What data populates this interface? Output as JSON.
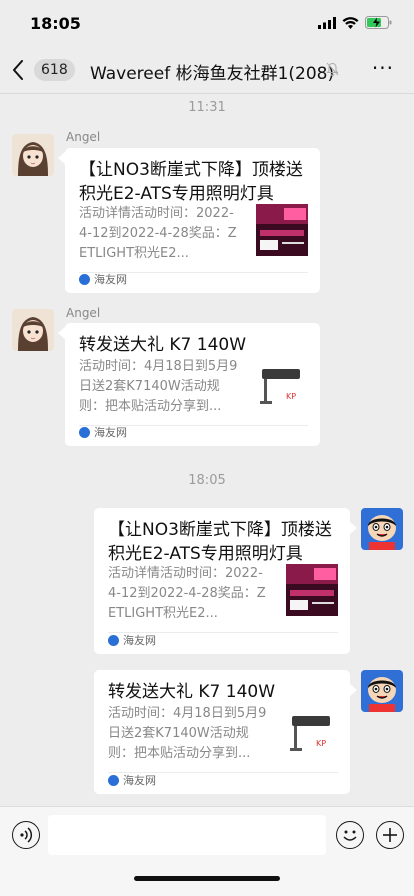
{
  "status_bar": {
    "time": "18:05"
  },
  "nav": {
    "back_icon": "chevron-left-icon",
    "unread_count": "618",
    "title": "Wavereef 彬海鱼友社群1(208)",
    "mute_icon": "mute-bell-icon",
    "more_label": "···"
  },
  "timestamps": [
    "11:31",
    "18:05"
  ],
  "messages": [
    {
      "sender": "Angel",
      "title": "【让NO3断崖式下降】顶楼送积光E2-ATS专用照明灯具",
      "desc": "活动详情活动时间：2022-4-12到2022-4-28奖品：ZETLIGHT积光E2...",
      "source": "海友网",
      "thumb_icon": "zetlight-promo-thumbnail"
    },
    {
      "sender": "Angel",
      "title": "转发送大礼 K7 140W",
      "desc": "活动时间：4月18日到5月9日送2套K7140W活动规则：把本贴活动分享到...",
      "source": "海友网",
      "thumb_icon": "k7-light-thumbnail"
    },
    {
      "sender": "",
      "title": "【让NO3断崖式下降】顶楼送积光E2-ATS专用照明灯具",
      "desc": "活动详情活动时间：2022-4-12到2022-4-28奖品：ZETLIGHT积光E2...",
      "source": "海友网",
      "thumb_icon": "zetlight-promo-thumbnail"
    },
    {
      "sender": "",
      "title": "转发送大礼 K7 140W",
      "desc": "活动时间：4月18日到5月9日送2套K7140W活动规则：把本贴活动分享到...",
      "source": "海友网",
      "thumb_icon": "k7-light-thumbnail"
    }
  ],
  "input_bar": {
    "voice_icon": "voice-icon",
    "emoji_icon": "emoji-icon",
    "plus_icon": "plus-icon"
  }
}
